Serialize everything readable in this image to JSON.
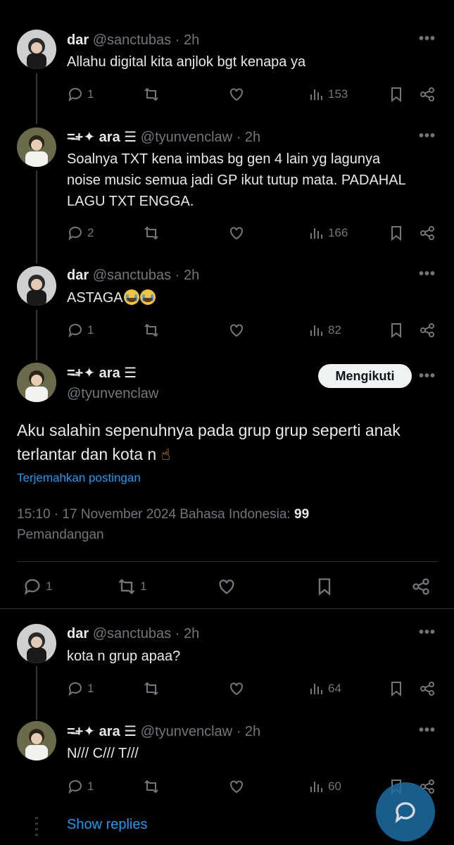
{
  "replies_above": [
    {
      "name": "dar",
      "handle": "@sanctubas",
      "time": "2h",
      "text": "Allahu digital kita anjlok bgt kenapa ya",
      "replies": "1",
      "reposts": "",
      "views": "153"
    },
    {
      "name": "=̶+✦ ara ☰",
      "handle": "@tyunvenclaw",
      "time": "2h",
      "text_lines": [
        "Soalnya TXT kena imbas bg gen 4 lain yg lagunya",
        "noise music semua jadi GP ikut tutup mata. PADAHAL",
        "LAGU TXT ENGGA."
      ],
      "replies": "2",
      "reposts": "",
      "views": "166"
    },
    {
      "name": "dar",
      "handle": "@sanctubas",
      "time": "2h",
      "text": "ASTAGA",
      "replies": "1",
      "reposts": "",
      "views": "82"
    }
  ],
  "main_post": {
    "name": "=̶+✦ ara ☰",
    "handle": "@tyunvenclaw",
    "follow_label": "Mengikuti",
    "text_line1": "Aku salahin sepenuhnya pada grup grup seperti anak",
    "text_line2": "terlantar dan kota n",
    "translate_label": "Terjemahkan postingan",
    "meta_text": "15:10 · 17 November 2024 Bahasa Indonesia: ",
    "views_count": "99",
    "views_label": "Pemandangan",
    "replies": "1",
    "reposts": "1"
  },
  "replies_below": [
    {
      "name": "dar",
      "handle": "@sanctubas",
      "time": "2h",
      "text": "kota n grup apaa?",
      "replies": "1",
      "views": "64"
    },
    {
      "name": "=̶+✦ ara ☰",
      "handle": "@tyunvenclaw",
      "time": "2h",
      "text": "N/// C/// T///",
      "replies": "1",
      "views": "60"
    }
  ],
  "show_replies_label": "Show replies",
  "separator": " · ",
  "more_label": "•••",
  "icons": [
    "reply-icon",
    "repost-icon",
    "like-icon",
    "views-icon",
    "bookmark-icon",
    "share-icon",
    "compose-reply-icon"
  ],
  "colors": {
    "background": "#000000",
    "accent": "#1d9bf0",
    "muted": "#71767b",
    "text": "#e7e9ea"
  }
}
